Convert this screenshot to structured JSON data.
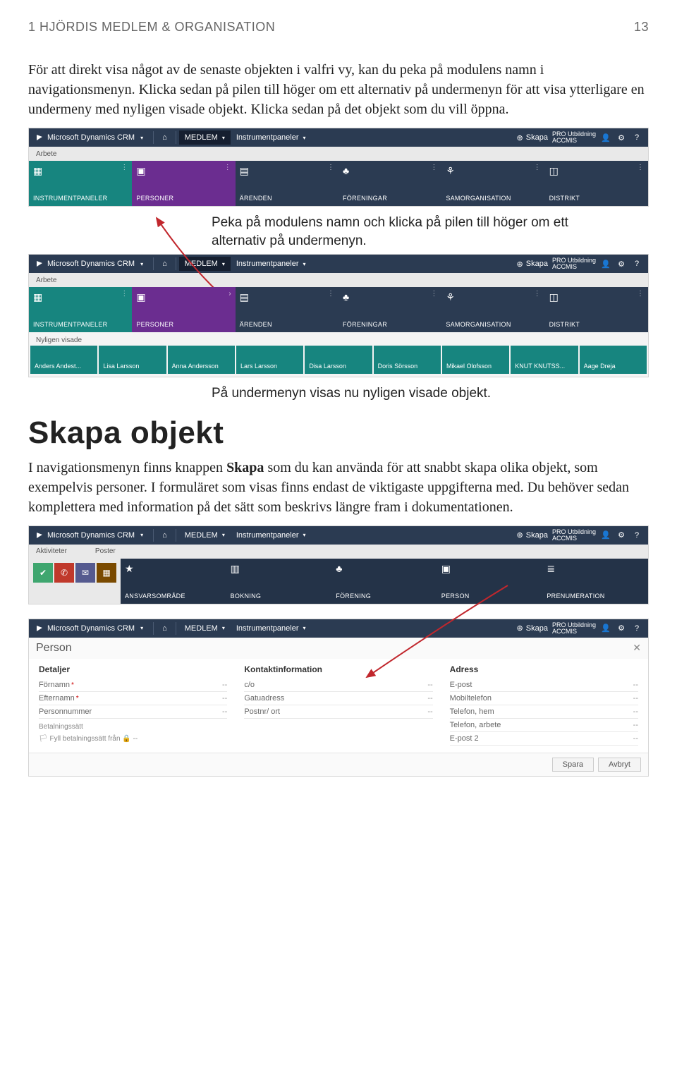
{
  "header": {
    "left": "1 HJÖRDIS MEDLEM & ORGANISATION",
    "right": "13"
  },
  "intro": "För att direkt visa något av de senaste objekten i valfri vy, kan du peka på modulens namn i navigationsmenyn. Klicka sedan på pilen till höger om ett alternativ på undermenyn för att visa ytterligare en undermeny med nyligen visade objekt. Klicka sedan på det objekt som du vill öppna.",
  "caption1": "Peka på modulens namn och klicka på pilen till höger om ett alternativ på undermenyn.",
  "caption2": "På undermenyn visas nu nyligen visade objekt.",
  "section_title": "Skapa objekt",
  "section_body_1": "I navigationsmenyn finns knappen ",
  "section_body_bold": "Skapa",
  "section_body_2": " som du kan använda för att snabbt skapa olika objekt, som exempelvis personer. I formuläret som visas finns endast de viktigaste uppgifterna med. Du behöver sedan komplettera med information på det sätt som beskrivs längre fram i dokumentationen.",
  "crm": {
    "brand": "Microsoft Dynamics CRM",
    "tab_active": "MEDLEM",
    "tab_sub": "Instrumentpaneler",
    "create": "Skapa",
    "user_line1": "PRO Utbildning",
    "user_line2": "ACCMIS",
    "sub_left": "Arbete",
    "sub_aktiv": "Aktiviteter",
    "sub_poster": "Poster",
    "tiles_main": [
      "INSTRUMENTPANELER",
      "PERSONER",
      "ÄRENDEN",
      "FÖRENINGAR",
      "SAMORGANISATION",
      "DISTRIKT"
    ],
    "tiles_create": [
      "ANSVARSOMRÅDE",
      "BOKNING",
      "FÖRENING",
      "PERSON",
      "PRENUMERATION"
    ],
    "recent_label": "Nyligen visade",
    "recent": [
      "Anders Andest...",
      "Lisa Larsson",
      "Anna Andersson",
      "Lars Larsson",
      "Disa Larsson",
      "Doris Sörsson",
      "Mikael Olofsson",
      "KNUT KNUTSS...",
      "Aage Dreja"
    ]
  },
  "form": {
    "title": "Person",
    "cols": {
      "details": {
        "h": "Detaljer",
        "fields": [
          {
            "l": "Förnamn",
            "req": true,
            "v": "--"
          },
          {
            "l": "Efternamn",
            "req": true,
            "v": "--"
          },
          {
            "l": "Personnummer",
            "req": false,
            "v": "--"
          }
        ],
        "extra_l": "Betalningssätt",
        "lock": "Fyll betalningssätt från"
      },
      "contact": {
        "h": "Kontaktinformation",
        "fields": [
          {
            "l": "c/o",
            "v": "--"
          },
          {
            "l": "Gatuadress",
            "v": "--"
          },
          {
            "l": "Postnr/ ort",
            "v": "--"
          }
        ]
      },
      "address": {
        "h": "Adress",
        "fields": [
          {
            "l": "E-post",
            "v": "--"
          },
          {
            "l": "Mobiltelefon",
            "v": "--"
          },
          {
            "l": "Telefon, hem",
            "v": "--"
          },
          {
            "l": "Telefon, arbete",
            "v": "--"
          },
          {
            "l": "E-post 2",
            "v": "--"
          }
        ]
      }
    },
    "btn_save": "Spara",
    "btn_cancel": "Avbryt"
  }
}
